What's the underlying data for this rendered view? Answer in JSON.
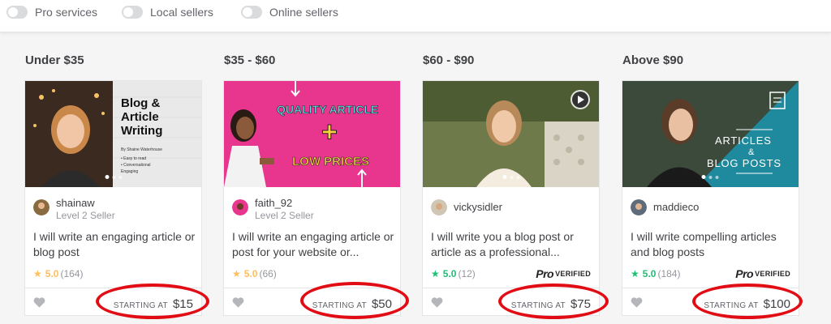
{
  "filters": [
    {
      "label": "Pro services"
    },
    {
      "label": "Local sellers"
    },
    {
      "label": "Online sellers"
    }
  ],
  "columns": [
    {
      "title": "Under $35",
      "card": {
        "seller": "shainaw",
        "level": "Level 2 Seller",
        "gig_title": "I will write an engaging article or blog post",
        "rating": "5.0",
        "reviews": "(164)",
        "pro": false,
        "starting_label": "STARTING AT",
        "price": "$15",
        "thumb_text": {
          "line1": "Blog &",
          "line2": "Article",
          "line3": "Writing",
          "byline": "By Shaine Waterhouse",
          "bullets": [
            "• Easy to read",
            "• Conversational",
            "Engaging"
          ]
        }
      }
    },
    {
      "title": "$35 - $60",
      "card": {
        "seller": "faith_92",
        "level": "Level 2 Seller",
        "gig_title": "I will write an engaging article or post for your website or...",
        "rating": "5.0",
        "reviews": "(66)",
        "pro": false,
        "starting_label": "STARTING AT",
        "price": "$50",
        "thumb_text": {
          "top": "QUALITY ARTICLE",
          "plus": "+",
          "bottom": "LOW PRICES"
        }
      }
    },
    {
      "title": "$60 - $90",
      "card": {
        "seller": "vickysidler",
        "level": "",
        "gig_title": "I will write you a blog post or article as a professional...",
        "rating": "5.0",
        "reviews": "(12)",
        "pro": true,
        "starting_label": "STARTING AT",
        "price": "$75"
      }
    },
    {
      "title": "Above $90",
      "card": {
        "seller": "maddieco",
        "level": "",
        "gig_title": "I will write compelling articles and blog posts",
        "rating": "5.0",
        "reviews": "(184)",
        "pro": true,
        "starting_label": "STARTING AT",
        "price": "$100",
        "thumb_text": {
          "line1": "ARTICLES",
          "line2": "&",
          "line3": "BLOG POSTS"
        }
      }
    }
  ],
  "pro_badge": {
    "pro": "Pro",
    "verified": "VERIFIED"
  },
  "colors": {
    "star_gold": "#ffbe5b",
    "star_teal": "#1dbf73",
    "annotation_red": "#e20d14",
    "pink_banner": "#e8368f",
    "teal_banner": "#1f8a9e"
  }
}
